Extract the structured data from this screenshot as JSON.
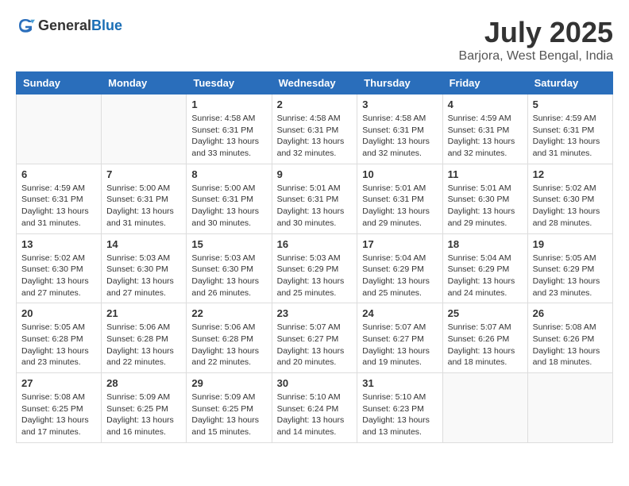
{
  "header": {
    "logo_general": "General",
    "logo_blue": "Blue",
    "title": "July 2025",
    "subtitle": "Barjora, West Bengal, India"
  },
  "days_of_week": [
    "Sunday",
    "Monday",
    "Tuesday",
    "Wednesday",
    "Thursday",
    "Friday",
    "Saturday"
  ],
  "weeks": [
    [
      {
        "day": "",
        "detail": ""
      },
      {
        "day": "",
        "detail": ""
      },
      {
        "day": "1",
        "detail": "Sunrise: 4:58 AM\nSunset: 6:31 PM\nDaylight: 13 hours and 33 minutes."
      },
      {
        "day": "2",
        "detail": "Sunrise: 4:58 AM\nSunset: 6:31 PM\nDaylight: 13 hours and 32 minutes."
      },
      {
        "day": "3",
        "detail": "Sunrise: 4:58 AM\nSunset: 6:31 PM\nDaylight: 13 hours and 32 minutes."
      },
      {
        "day": "4",
        "detail": "Sunrise: 4:59 AM\nSunset: 6:31 PM\nDaylight: 13 hours and 32 minutes."
      },
      {
        "day": "5",
        "detail": "Sunrise: 4:59 AM\nSunset: 6:31 PM\nDaylight: 13 hours and 31 minutes."
      }
    ],
    [
      {
        "day": "6",
        "detail": "Sunrise: 4:59 AM\nSunset: 6:31 PM\nDaylight: 13 hours and 31 minutes."
      },
      {
        "day": "7",
        "detail": "Sunrise: 5:00 AM\nSunset: 6:31 PM\nDaylight: 13 hours and 31 minutes."
      },
      {
        "day": "8",
        "detail": "Sunrise: 5:00 AM\nSunset: 6:31 PM\nDaylight: 13 hours and 30 minutes."
      },
      {
        "day": "9",
        "detail": "Sunrise: 5:01 AM\nSunset: 6:31 PM\nDaylight: 13 hours and 30 minutes."
      },
      {
        "day": "10",
        "detail": "Sunrise: 5:01 AM\nSunset: 6:31 PM\nDaylight: 13 hours and 29 minutes."
      },
      {
        "day": "11",
        "detail": "Sunrise: 5:01 AM\nSunset: 6:30 PM\nDaylight: 13 hours and 29 minutes."
      },
      {
        "day": "12",
        "detail": "Sunrise: 5:02 AM\nSunset: 6:30 PM\nDaylight: 13 hours and 28 minutes."
      }
    ],
    [
      {
        "day": "13",
        "detail": "Sunrise: 5:02 AM\nSunset: 6:30 PM\nDaylight: 13 hours and 27 minutes."
      },
      {
        "day": "14",
        "detail": "Sunrise: 5:03 AM\nSunset: 6:30 PM\nDaylight: 13 hours and 27 minutes."
      },
      {
        "day": "15",
        "detail": "Sunrise: 5:03 AM\nSunset: 6:30 PM\nDaylight: 13 hours and 26 minutes."
      },
      {
        "day": "16",
        "detail": "Sunrise: 5:03 AM\nSunset: 6:29 PM\nDaylight: 13 hours and 25 minutes."
      },
      {
        "day": "17",
        "detail": "Sunrise: 5:04 AM\nSunset: 6:29 PM\nDaylight: 13 hours and 25 minutes."
      },
      {
        "day": "18",
        "detail": "Sunrise: 5:04 AM\nSunset: 6:29 PM\nDaylight: 13 hours and 24 minutes."
      },
      {
        "day": "19",
        "detail": "Sunrise: 5:05 AM\nSunset: 6:29 PM\nDaylight: 13 hours and 23 minutes."
      }
    ],
    [
      {
        "day": "20",
        "detail": "Sunrise: 5:05 AM\nSunset: 6:28 PM\nDaylight: 13 hours and 23 minutes."
      },
      {
        "day": "21",
        "detail": "Sunrise: 5:06 AM\nSunset: 6:28 PM\nDaylight: 13 hours and 22 minutes."
      },
      {
        "day": "22",
        "detail": "Sunrise: 5:06 AM\nSunset: 6:28 PM\nDaylight: 13 hours and 22 minutes."
      },
      {
        "day": "23",
        "detail": "Sunrise: 5:07 AM\nSunset: 6:27 PM\nDaylight: 13 hours and 20 minutes."
      },
      {
        "day": "24",
        "detail": "Sunrise: 5:07 AM\nSunset: 6:27 PM\nDaylight: 13 hours and 19 minutes."
      },
      {
        "day": "25",
        "detail": "Sunrise: 5:07 AM\nSunset: 6:26 PM\nDaylight: 13 hours and 18 minutes."
      },
      {
        "day": "26",
        "detail": "Sunrise: 5:08 AM\nSunset: 6:26 PM\nDaylight: 13 hours and 18 minutes."
      }
    ],
    [
      {
        "day": "27",
        "detail": "Sunrise: 5:08 AM\nSunset: 6:25 PM\nDaylight: 13 hours and 17 minutes."
      },
      {
        "day": "28",
        "detail": "Sunrise: 5:09 AM\nSunset: 6:25 PM\nDaylight: 13 hours and 16 minutes."
      },
      {
        "day": "29",
        "detail": "Sunrise: 5:09 AM\nSunset: 6:25 PM\nDaylight: 13 hours and 15 minutes."
      },
      {
        "day": "30",
        "detail": "Sunrise: 5:10 AM\nSunset: 6:24 PM\nDaylight: 13 hours and 14 minutes."
      },
      {
        "day": "31",
        "detail": "Sunrise: 5:10 AM\nSunset: 6:23 PM\nDaylight: 13 hours and 13 minutes."
      },
      {
        "day": "",
        "detail": ""
      },
      {
        "day": "",
        "detail": ""
      }
    ]
  ]
}
